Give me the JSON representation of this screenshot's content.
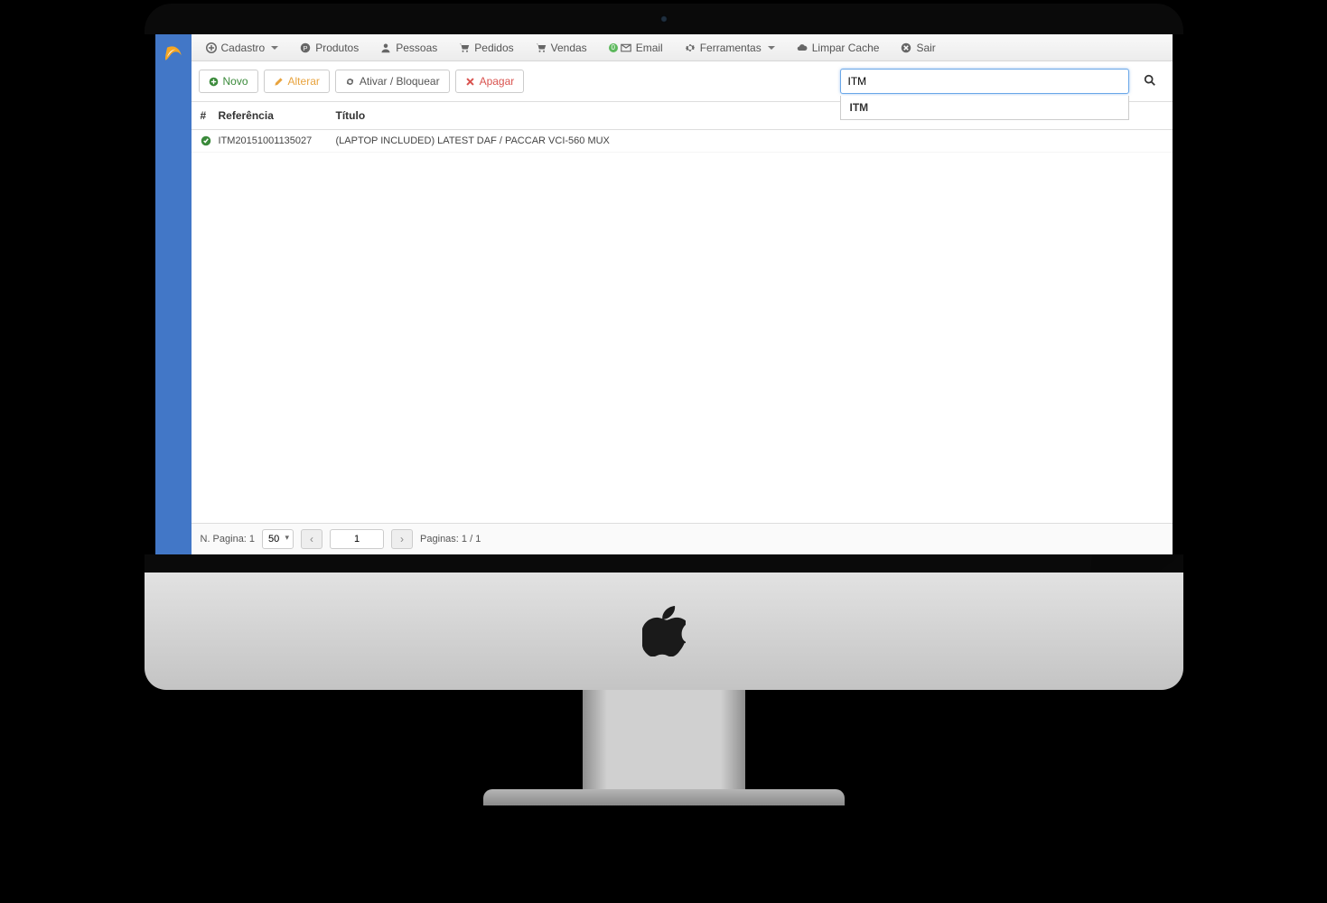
{
  "nav": {
    "cadastro": "Cadastro",
    "produtos": "Produtos",
    "pessoas": "Pessoas",
    "pedidos": "Pedidos",
    "vendas": "Vendas",
    "email_badge": "0",
    "email": "Email",
    "ferramentas": "Ferramentas",
    "limpar_cache": "Limpar Cache",
    "sair": "Sair"
  },
  "toolbar": {
    "novo": "Novo",
    "alterar": "Alterar",
    "ativar": "Ativar / Bloquear",
    "apagar": "Apagar"
  },
  "search": {
    "value": "ITM",
    "suggestions": [
      "ITM"
    ]
  },
  "columns": {
    "hash": "#",
    "referencia": "Referência",
    "titulo": "Título"
  },
  "rows": [
    {
      "referencia": "ITM20151001135027",
      "titulo": "(LAPTOP INCLUDED) LATEST DAF / PACCAR VCI-560 MUX"
    }
  ],
  "footer": {
    "n_pagina_label": "N. Pagina: 1",
    "per_page_value": "50",
    "page_input": "1",
    "paginas_label": "Paginas: 1 / 1"
  }
}
